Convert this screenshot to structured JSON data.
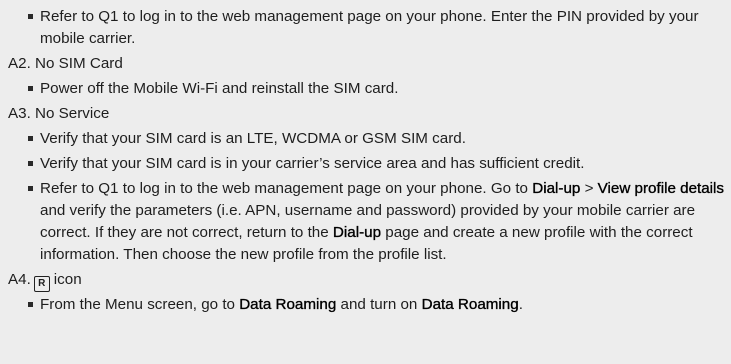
{
  "q2": {
    "bullets": [
      [
        "Refer to Q1 to log in to the web management page on your phone. Enter the PIN provided by your mobile carrier."
      ]
    ]
  },
  "a2": {
    "heading": "A2. No SIM Card",
    "bullets": [
      "Power off the Mobile Wi-Fi and reinstall the SIM card."
    ]
  },
  "a3": {
    "heading": "A3. No Service",
    "bullets": [
      "Verify that your SIM card is an LTE, WCDMA or GSM SIM card.",
      "Verify that your SIM card is in your carrier’s service area and has sufficient credit."
    ],
    "bullet3": {
      "t1": "Refer to Q1 to log in to the web management page on your phone. Go to ",
      "b1": "Dial-up",
      "t2": " > ",
      "b2": "View profile details",
      "t3": " and verify the parameters (i.e. APN, username and password) provided by your mobile carrier are correct. If they are not correct, return to the ",
      "b3": "Dial-up",
      "t4": " page and create a new profile with the correct information. Then choose the new profile from the profile list."
    }
  },
  "a4": {
    "heading_prefix": "A4.",
    "icon_letter": "R",
    "heading_suffix": "icon",
    "bullet": {
      "t1": "From the Menu screen, go to ",
      "b1": "Data Roaming",
      "t2": " and turn on ",
      "b2": "Data Roaming",
      "t3": "."
    }
  }
}
